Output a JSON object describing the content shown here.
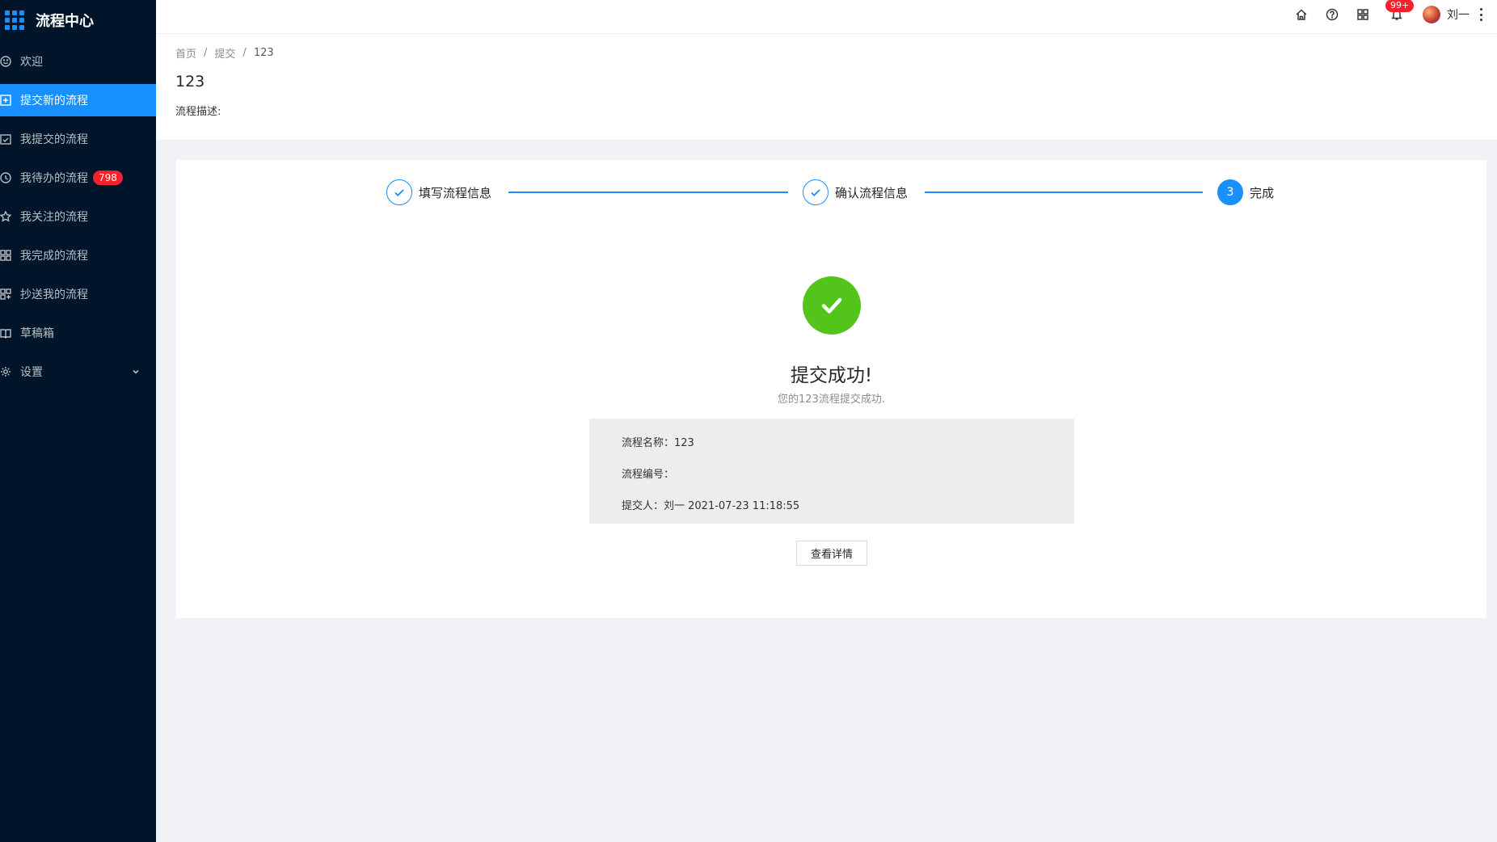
{
  "app": {
    "title": "流程中心"
  },
  "sidebar": {
    "items": [
      {
        "label": "欢迎",
        "icon": "smile-icon"
      },
      {
        "label": "提交新的流程",
        "icon": "plus-square-icon",
        "active": true
      },
      {
        "label": "我提交的流程",
        "icon": "check-square-icon"
      },
      {
        "label": "我待办的流程",
        "icon": "clock-icon",
        "badge": "798"
      },
      {
        "label": "我关注的流程",
        "icon": "star-icon"
      },
      {
        "label": "我完成的流程",
        "icon": "grid-icon"
      },
      {
        "label": "抄送我的流程",
        "icon": "copy-icon"
      },
      {
        "label": "草稿箱",
        "icon": "book-icon"
      },
      {
        "label": "设置",
        "icon": "gear-icon",
        "has_submenu": true
      }
    ]
  },
  "header": {
    "notification_badge": "99+",
    "username": "刘一"
  },
  "breadcrumb": {
    "home": "首页",
    "parent": "提交",
    "current": "123"
  },
  "page": {
    "title": "123",
    "description_label": "流程描述:"
  },
  "steps": [
    {
      "title": "填写流程信息",
      "status": "finished"
    },
    {
      "title": "确认流程信息",
      "status": "finished"
    },
    {
      "number": "3",
      "title": "完成",
      "status": "active"
    }
  ],
  "result": {
    "title": "提交成功!",
    "subtitle": "您的123流程提交成功.",
    "info": {
      "name_row": "流程名称：123",
      "number_row": "流程编号：",
      "submitter_row": "提交人：刘一 2021-07-23 11:18:55"
    },
    "button_label": "查看详情"
  },
  "colors": {
    "primary": "#1890ff",
    "sidebar_bg": "#001529",
    "success": "#52c41a",
    "badge": "#f5222d"
  }
}
